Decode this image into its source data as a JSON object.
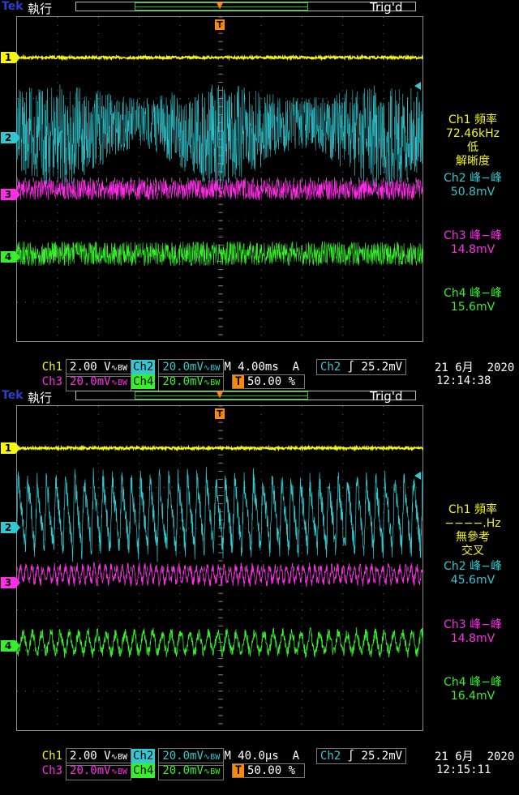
{
  "colors": {
    "ch1": "#f5f512",
    "ch2": "#33c7d0",
    "ch3": "#ff2ce8",
    "ch4": "#35f02a",
    "trigger": "#ff8a00",
    "grid": "#7a7a7a"
  },
  "screens": [
    {
      "logo": "Tek",
      "run_status": "執行",
      "trig_status": "Trig'd",
      "trigger_marker": "T",
      "channel_markers": [
        "1",
        "2",
        "3",
        "4"
      ],
      "measurements": [
        {
          "label": "Ch1 頻率",
          "value": "72.46kHz",
          "note1": "低",
          "note2": "解晰度"
        },
        {
          "label": "Ch2 峰−峰",
          "value": "50.8mV"
        },
        {
          "label": "Ch3 峰−峰",
          "value": "14.8mV"
        },
        {
          "label": "Ch4 峰−峰",
          "value": "15.6mV"
        }
      ],
      "scale": {
        "ch1_name": "Ch1",
        "ch1_value": "2.00 V",
        "ch1_coupling": "∿BW",
        "ch2_name": "Ch2",
        "ch2_value": "20.0mV",
        "ch2_coupling": "∿BW",
        "ch3_name": "Ch3",
        "ch3_value": "20.0mV",
        "ch3_coupling": "∿BW",
        "ch4_name": "Ch4",
        "ch4_value": "20.0mV",
        "ch4_coupling": "∿BW",
        "timebase": "M 4.00ms",
        "acq_mode": "A",
        "trig_source": "Ch2",
        "trig_slope": "∫",
        "trig_level": "25.2mV",
        "trig_position": "50.00 %"
      },
      "date": "21 6月  2020",
      "time": "12:14:38"
    },
    {
      "logo": "Tek",
      "run_status": "執行",
      "trig_status": "Trig'd",
      "trigger_marker": "T",
      "channel_markers": [
        "1",
        "2",
        "3",
        "4"
      ],
      "measurements": [
        {
          "label": "Ch1 頻率",
          "value": "−−−−.Hz",
          "note1": "無參考",
          "note2": "交叉"
        },
        {
          "label": "Ch2 峰−峰",
          "value": "45.6mV"
        },
        {
          "label": "Ch3 峰−峰",
          "value": "14.8mV"
        },
        {
          "label": "Ch4 峰−峰",
          "value": "16.4mV"
        }
      ],
      "scale": {
        "ch1_name": "Ch1",
        "ch1_value": "2.00 V",
        "ch1_coupling": "∿BW",
        "ch2_name": "Ch2",
        "ch2_value": "20.0mV",
        "ch2_coupling": "∿BW",
        "ch3_name": "Ch3",
        "ch3_value": "20.0mV",
        "ch3_coupling": "∿BW",
        "ch4_name": "Ch4",
        "ch4_value": "20.0mV",
        "ch4_coupling": "∿BW",
        "timebase": "M 40.0µs",
        "acq_mode": "A",
        "trig_source": "Ch2",
        "trig_slope": "∫",
        "trig_level": "25.2mV",
        "trig_position": "50.00 %"
      },
      "date": "21 6月  2020",
      "time": "12:15:11"
    }
  ]
}
